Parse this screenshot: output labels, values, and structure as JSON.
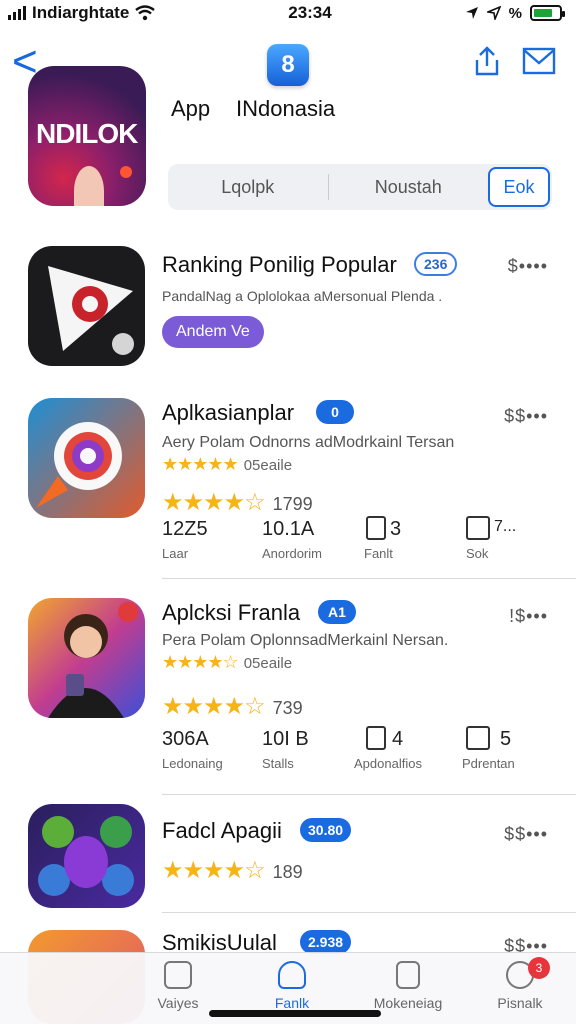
{
  "status_bar": {
    "carrier": "Indiarghtate",
    "time": "23:34",
    "battery_label": "%"
  },
  "nav": {
    "back_label": "<",
    "store_icon_glyph": "8"
  },
  "hero": {
    "logo_word": "NDILOK"
  },
  "store": {
    "title_a": "App",
    "title_b": "INdonasia"
  },
  "segments": [
    {
      "label": "Lqolpk"
    },
    {
      "label": "Noustah"
    },
    {
      "label": "Eok"
    }
  ],
  "apps": [
    {
      "title": "Ranking Ponilig Popular",
      "badge": "236",
      "price": "$••••",
      "desc": "PandalNag a Oplolokaa aMersonual Plenda .",
      "open_label": "Andem Ve"
    },
    {
      "title": "Aplkasianplar",
      "badge": "0",
      "price": "$$•••",
      "desc": "Aery Polam Odnorns adModrkainl Tersan",
      "stars_label": "05eaile",
      "rating_count": "1799",
      "stats": [
        {
          "value": "12Z5",
          "label": "Laar"
        },
        {
          "value": "10.1A",
          "label": "Anordorim"
        },
        {
          "value": "3",
          "label": "Fanlt"
        },
        {
          "value": "7...",
          "label": "Sok"
        }
      ]
    },
    {
      "title": "Aplcksi Franla",
      "badge": "A1",
      "price": "!$•••",
      "desc": "Pera Polam OplonnsadMerkainl Nersan.",
      "stars_label": "05eaile",
      "rating_count": "739",
      "stats": [
        {
          "value": "306A",
          "label": "Ledonaing"
        },
        {
          "value": "10I B",
          "label": "Stalls"
        },
        {
          "value": "4",
          "label": "Apdonalfios"
        },
        {
          "value": "5",
          "label": "Pdrentan"
        }
      ]
    },
    {
      "title": "Fadcl Apagii",
      "badge": "30.80",
      "price": "$$•••",
      "rating_count": "189"
    },
    {
      "title": "SmikisUulal",
      "badge": "2.938",
      "price": "$$•••"
    }
  ],
  "tabs": [
    {
      "label": "Vaiyes"
    },
    {
      "label": "Fanlk"
    },
    {
      "label": "Mokeneiag"
    },
    {
      "label": "Pisnalk",
      "badge": "3"
    }
  ],
  "colors": {
    "accent": "#1a6be0",
    "star": "#f5b417",
    "open_button": "#7b5cd6",
    "battery": "#1fa339"
  }
}
